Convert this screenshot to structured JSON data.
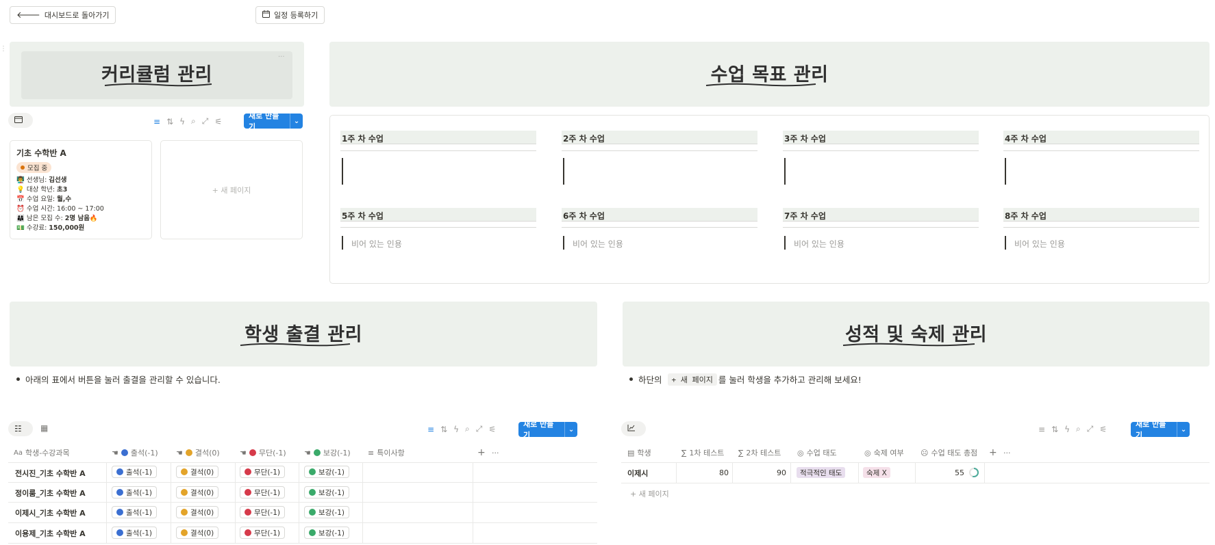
{
  "top_buttons": {
    "back_label": "대시보드로 돌아가기",
    "schedule_label": "일정 등록하기"
  },
  "curriculum": {
    "title": "커리큘럼 관리",
    "new_label": "새로 만들기",
    "card": {
      "title": "기초 수학반 A",
      "status": "모집 중",
      "teacher_key": "선생님:",
      "teacher_val": "김선생",
      "grade_key": "대상 학년:",
      "grade_val": "초3",
      "days_key": "수업 요일:",
      "days_val": "월,수",
      "time_key": "수업 시간:",
      "time_val": "16:00 ~ 17:00",
      "seats_key": "남은 모집 수:",
      "seats_val": "2명 남음🔥",
      "fee_key": "수강료:",
      "fee_val": "150,000원"
    },
    "new_page": "+ 새 페이지"
  },
  "goals": {
    "title": "수업 목표 관리",
    "weeks": [
      "1주 차 수업",
      "2주 차 수업",
      "3주 차 수업",
      "4주 차 수업",
      "5주 차 수업",
      "6주 차 수업",
      "7주 차 수업",
      "8주 차 수업"
    ],
    "empty_quote": "비어 있는 인용"
  },
  "attendance": {
    "title": "학생 출결 관리",
    "bullet": "아래의 표에서 버튼을 눌러 출결을 관리할 수 있습니다.",
    "new_label": "새로 만들기",
    "headers": [
      "학생-수강과목",
      "출석(-1)",
      "결석(0)",
      "무단(-1)",
      "보강(-1)",
      "특이사항"
    ],
    "rows": [
      {
        "name": "전시진_기초 수학반 A"
      },
      {
        "name": "정이룸_기초 수학반 A"
      },
      {
        "name": "이제시_기초 수학반 A"
      },
      {
        "name": "이용제_기초 수학반 A"
      }
    ],
    "buttons": [
      "출석(-1)",
      "결석(0)",
      "무단(-1)",
      "보강(-1)"
    ],
    "colors": {
      "present": "#3b6fd1",
      "absent": "#e3a42a",
      "unexcused": "#d63a4a",
      "makeup": "#3aaa6a"
    }
  },
  "grades": {
    "title": "성적 및 숙제 관리",
    "bullet_pre": "하단의",
    "bullet_kbd": "+ 새 페이지",
    "bullet_post": "를 눌러 학생을 추가하고 관리해 보세요!",
    "new_label": "새로 만들기",
    "headers": [
      "학생",
      "1차 테스트",
      "2차 테스트",
      "수업 태도",
      "숙제 여부",
      "수업 태도 총점"
    ],
    "row": {
      "name": "이제시",
      "test1": "80",
      "test2": "90",
      "attitude": "적극적인 태도",
      "homework": "숙제 X",
      "total": "55"
    },
    "new_page": "+ 새 페이지"
  }
}
